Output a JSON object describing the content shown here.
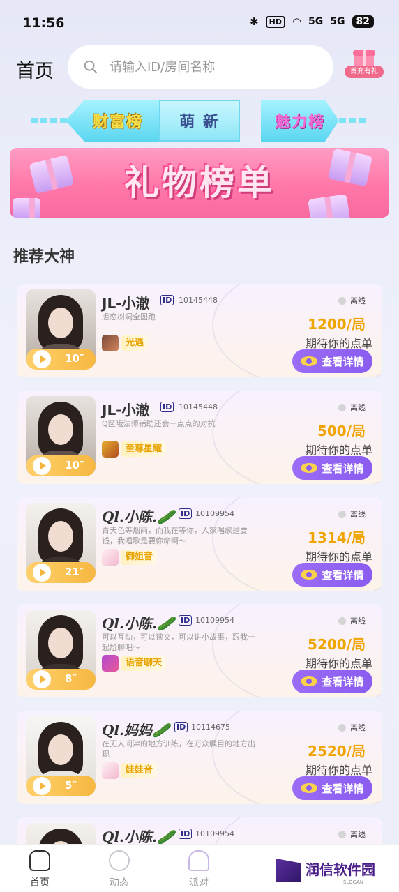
{
  "status_bar": {
    "time": "11:56",
    "hd": "HD",
    "net1": "5G",
    "net2": "5G",
    "battery": "82"
  },
  "header": {
    "title": "首页",
    "search_placeholder": "请输入ID/房间名称",
    "gift_label": "首充有礼"
  },
  "ranks": {
    "wealth": "财富榜",
    "newbie": "萌 新",
    "charm": "魅力榜"
  },
  "banner": {
    "title": "礼物榜单"
  },
  "section_title": "推荐大神",
  "cards": [
    {
      "name": "JL-小澈",
      "id": "10145448",
      "desc": "虐恋树洞全图跑",
      "game": "光遇",
      "duration": "10″",
      "status": "离线",
      "price": "1200/局",
      "hint": "期待你的点单",
      "button": "查看详情"
    },
    {
      "name": "JL-小澈",
      "id": "10145448",
      "desc": "Q区哦法师辅助还会一点点的对抗",
      "game": "至尊星耀",
      "duration": "10″",
      "status": "离线",
      "price": "500/局",
      "hint": "期待你的点单",
      "button": "查看详情"
    },
    {
      "name": "Ql.小陈.🥒",
      "id": "10109954",
      "desc": "青天色等烟雨，而我在等你，人家唱歌是要钱，我唱歌是要你命啊～",
      "game": "御姐音",
      "duration": "21″",
      "status": "离线",
      "price": "1314/局",
      "hint": "期待你的点单",
      "button": "查看详情"
    },
    {
      "name": "Ql.小陈.🥒",
      "id": "10109954",
      "desc": "可以互动，可以读文，可以讲小故事，跟我一起尬聊吧～",
      "game": "语音聊天",
      "duration": "8″",
      "status": "离线",
      "price": "5200/局",
      "hint": "期待你的点单",
      "button": "查看详情"
    },
    {
      "name": "Ql.妈妈🥒",
      "id": "10114675",
      "desc": "在无人问津的地方训练，在万众瞩目的地方出现",
      "game": "娃娃音",
      "duration": "5″",
      "status": "离线",
      "price": "2520/局",
      "hint": "期待你的点单",
      "button": "查看详情"
    },
    {
      "name": "Ql.小陈.🥒",
      "id": "10109954",
      "desc": "",
      "game": "",
      "duration": "",
      "status": "离线",
      "price": "",
      "hint": "",
      "button": ""
    }
  ],
  "bottom_nav": [
    {
      "label": "首页",
      "icon": "home-icon"
    },
    {
      "label": "动态",
      "icon": "star-icon"
    },
    {
      "label": "派对",
      "icon": "party-icon"
    }
  ],
  "watermark": {
    "text": "润信软件园",
    "slogan": "SLOGAN"
  }
}
